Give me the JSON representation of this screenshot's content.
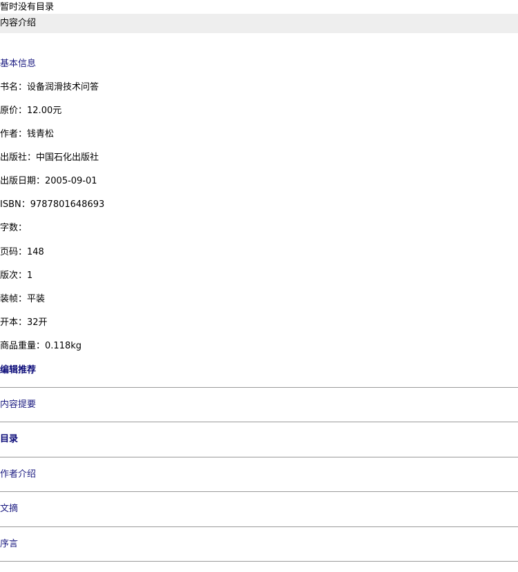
{
  "top_note": "暂时没有目录",
  "intro_bar": {
    "label": "内容介绍"
  },
  "basic_info": {
    "title": "基本信息",
    "rows": [
      {
        "label": "书名：",
        "value": "设备润滑技术问答"
      },
      {
        "label": "原价：",
        "value": "12.00元"
      },
      {
        "label": "作者：",
        "value": "钱青松"
      },
      {
        "label": "出版社：",
        "value": "中国石化出版社"
      },
      {
        "label": "出版日期：",
        "value": "2005-09-01"
      },
      {
        "label": "ISBN：",
        "value": "9787801648693"
      },
      {
        "label": "字数：",
        "value": ""
      },
      {
        "label": "页码：",
        "value": "148"
      },
      {
        "label": "版次：",
        "value": "1"
      },
      {
        "label": "装帧：",
        "value": "平装"
      },
      {
        "label": "开本：",
        "value": "32开"
      },
      {
        "label": "商品重量：",
        "value": "0.118kg"
      }
    ]
  },
  "sections": [
    {
      "label": "编辑推荐"
    },
    {
      "label": "内容提要"
    },
    {
      "label": "目录"
    },
    {
      "label": "作者介绍"
    },
    {
      "label": "文摘"
    },
    {
      "label": "序言"
    }
  ]
}
